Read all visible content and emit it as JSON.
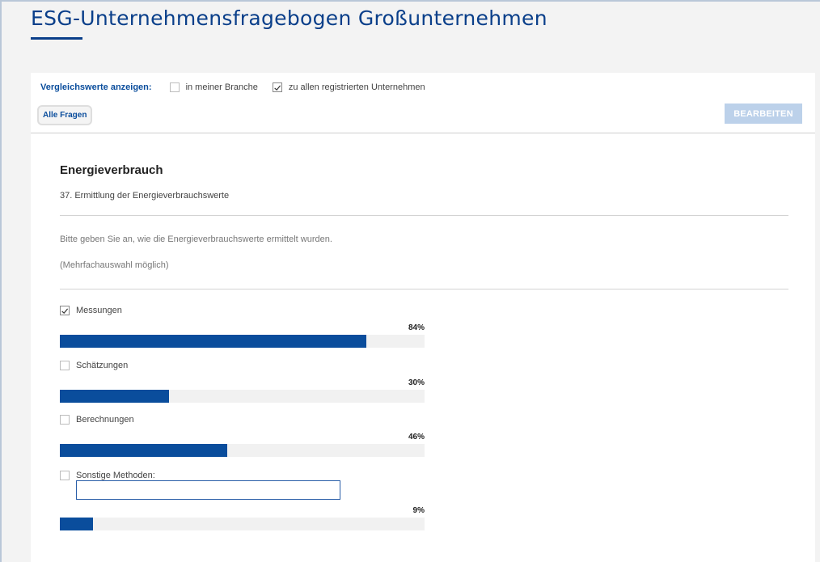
{
  "header": {
    "title": "ESG-Unternehmensfragebogen Großunternehmen"
  },
  "comparison": {
    "label": "Vergleichswerte anzeigen:",
    "options": [
      {
        "label": "in meiner Branche",
        "checked": false
      },
      {
        "label": "zu allen registrierten Unternehmen",
        "checked": true
      }
    ]
  },
  "toolbar": {
    "all_questions_label": "Alle Fragen",
    "edit_label": "BEARBEITEN"
  },
  "section": {
    "title": "Energieverbrauch",
    "question": "37. Ermittlung der Energieverbrauchswerte",
    "instruction": "Bitte geben Sie an, wie die Energieverbrauchswerte ermittelt wurden.",
    "hint": "(Mehrfachauswahl möglich)"
  },
  "answers": [
    {
      "label": "Messungen",
      "checked": true,
      "percent": 84,
      "percent_label": "84%"
    },
    {
      "label": "Schätzungen",
      "checked": false,
      "percent": 30,
      "percent_label": "30%"
    },
    {
      "label": "Berechnungen",
      "checked": false,
      "percent": 46,
      "percent_label": "46%"
    },
    {
      "label": "Sonstige Methoden:",
      "checked": false,
      "percent": 9,
      "percent_label": "9%",
      "input_value": ""
    }
  ],
  "colors": {
    "brand": "#0a3f8a",
    "accent": "#0a4d9c",
    "edit_button_disabled": "#bcd1ea",
    "bar_track": "#f1f1f1"
  }
}
